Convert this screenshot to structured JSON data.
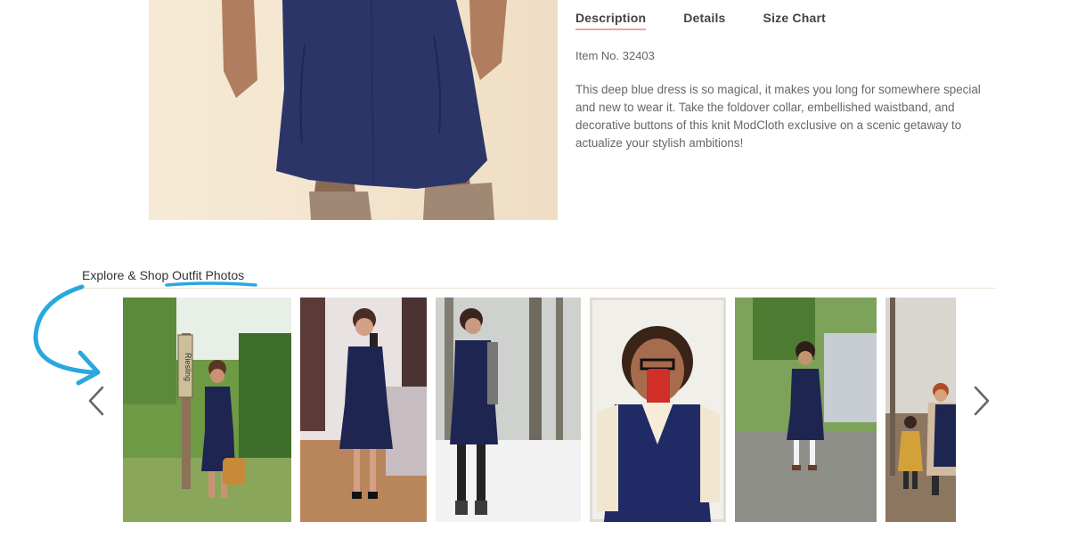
{
  "tabs": [
    {
      "label": "Description",
      "active": true
    },
    {
      "label": "Details",
      "active": false
    },
    {
      "label": "Size Chart",
      "active": false
    }
  ],
  "item_number": "Item No. 32403",
  "description": "This deep blue dress is so magical, it makes you long for somewhere special and new to wear it. Take the foldover collar, embellished waistband, and decorative buttons of this knit ModCloth exclusive on a scenic getaway to actualize your stylish ambitions!",
  "explore": {
    "prefix": "Explore & Shop ",
    "highlight": "Outfit Photos"
  },
  "carousel": {
    "prev_icon": "chevron-left-icon",
    "next_icon": "chevron-right-icon",
    "photos": [
      {
        "name": "outfit-photo-vineyard",
        "sign_text": "Riesling"
      },
      {
        "name": "outfit-photo-mirror-selfie-1"
      },
      {
        "name": "outfit-photo-snow"
      },
      {
        "name": "outfit-photo-mirror-selfie-2"
      },
      {
        "name": "outfit-photo-backyard"
      },
      {
        "name": "outfit-photo-family"
      }
    ]
  },
  "colors": {
    "accent_underline": "#e8a89a",
    "annotation_blue": "#29a8e0",
    "dress_navy": "#2b3568"
  }
}
